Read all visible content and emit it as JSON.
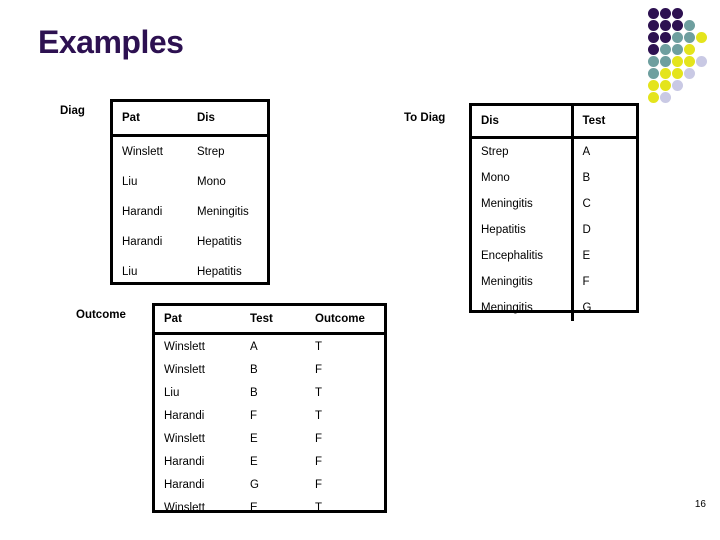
{
  "slide": {
    "title": "Examples",
    "page_number": "16",
    "title_color": "#2d1151"
  },
  "decoration": {
    "name": "dot-grid",
    "colors": {
      "purple": "#2d1151",
      "teal": "#6e9f9f",
      "yellow": "#e4e41c",
      "lavender": "#c9c9e4"
    },
    "dots": [
      {
        "row": 0,
        "col": 0,
        "color": "#2d1151"
      },
      {
        "row": 0,
        "col": 1,
        "color": "#2d1151"
      },
      {
        "row": 0,
        "col": 2,
        "color": "#2d1151"
      },
      {
        "row": 1,
        "col": 0,
        "color": "#2d1151"
      },
      {
        "row": 1,
        "col": 1,
        "color": "#2d1151"
      },
      {
        "row": 1,
        "col": 2,
        "color": "#2d1151"
      },
      {
        "row": 1,
        "col": 3,
        "color": "#6e9f9f"
      },
      {
        "row": 2,
        "col": 0,
        "color": "#2d1151"
      },
      {
        "row": 2,
        "col": 1,
        "color": "#2d1151"
      },
      {
        "row": 2,
        "col": 2,
        "color": "#6e9f9f"
      },
      {
        "row": 2,
        "col": 3,
        "color": "#6e9f9f"
      },
      {
        "row": 2,
        "col": 4,
        "color": "#e4e41c"
      },
      {
        "row": 3,
        "col": 0,
        "color": "#2d1151"
      },
      {
        "row": 3,
        "col": 1,
        "color": "#6e9f9f"
      },
      {
        "row": 3,
        "col": 2,
        "color": "#6e9f9f"
      },
      {
        "row": 3,
        "col": 3,
        "color": "#e4e41c"
      },
      {
        "row": 4,
        "col": 0,
        "color": "#6e9f9f"
      },
      {
        "row": 4,
        "col": 1,
        "color": "#6e9f9f"
      },
      {
        "row": 4,
        "col": 2,
        "color": "#e4e41c"
      },
      {
        "row": 4,
        "col": 3,
        "color": "#e4e41c"
      },
      {
        "row": 4,
        "col": 4,
        "color": "#c9c9e4"
      },
      {
        "row": 5,
        "col": 0,
        "color": "#6e9f9f"
      },
      {
        "row": 5,
        "col": 1,
        "color": "#e4e41c"
      },
      {
        "row": 5,
        "col": 2,
        "color": "#e4e41c"
      },
      {
        "row": 5,
        "col": 3,
        "color": "#c9c9e4"
      },
      {
        "row": 6,
        "col": 0,
        "color": "#e4e41c"
      },
      {
        "row": 6,
        "col": 1,
        "color": "#e4e41c"
      },
      {
        "row": 6,
        "col": 2,
        "color": "#c9c9e4"
      },
      {
        "row": 7,
        "col": 0,
        "color": "#e4e41c"
      },
      {
        "row": 7,
        "col": 1,
        "color": "#c9c9e4"
      }
    ]
  },
  "tables": {
    "diag": {
      "label": "Diag",
      "headers": [
        "Pat",
        "Dis"
      ],
      "rows": [
        [
          "Winslett",
          "Strep"
        ],
        [
          "Liu",
          "Mono"
        ],
        [
          "Harandi",
          "Meningitis"
        ],
        [
          "Harandi",
          "Hepatitis"
        ],
        [
          "Liu",
          "Hepatitis"
        ]
      ]
    },
    "to_diag": {
      "label": "To Diag",
      "headers": [
        "Dis",
        "Test"
      ],
      "rows": [
        [
          "Strep",
          "A"
        ],
        [
          "Mono",
          "B"
        ],
        [
          "Meningitis",
          "C"
        ],
        [
          "Hepatitis",
          "D"
        ],
        [
          "Encephalitis",
          "E"
        ],
        [
          "Meningitis",
          "F"
        ],
        [
          "Meningitis",
          "G"
        ]
      ]
    },
    "outcome": {
      "label": "Outcome",
      "headers": [
        "Pat",
        "Test",
        "Outcome"
      ],
      "rows": [
        [
          "Winslett",
          "A",
          "T"
        ],
        [
          "Winslett",
          "B",
          "F"
        ],
        [
          "Liu",
          "B",
          "T"
        ],
        [
          "Harandi",
          "F",
          "T"
        ],
        [
          "Winslett",
          "E",
          "F"
        ],
        [
          "Harandi",
          "E",
          "F"
        ],
        [
          "Harandi",
          "G",
          "F"
        ],
        [
          "Winslett",
          "E",
          "T"
        ]
      ]
    }
  }
}
